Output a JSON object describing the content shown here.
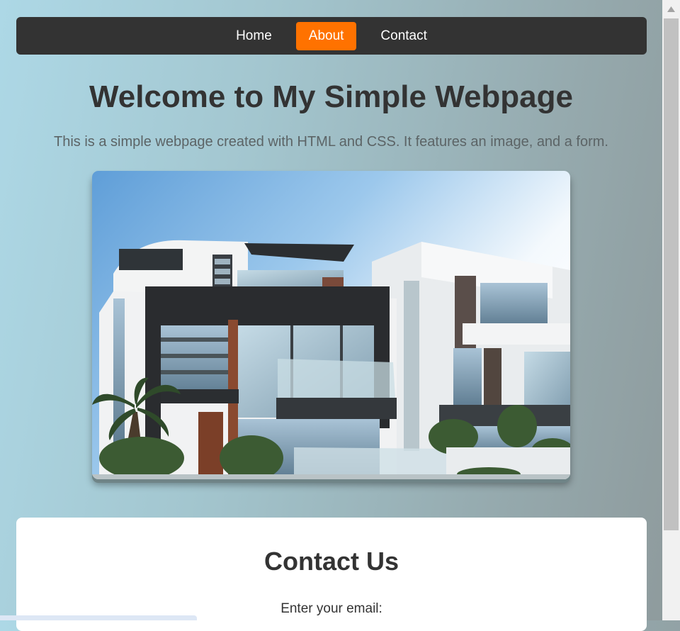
{
  "nav": {
    "items": [
      {
        "label": "Home",
        "active": false
      },
      {
        "label": "About",
        "active": true
      },
      {
        "label": "Contact",
        "active": false
      }
    ],
    "active_color": "#ff7200",
    "background": "#333333"
  },
  "main": {
    "title": "Welcome to My Simple Webpage",
    "intro": "This is a simple webpage created with HTML and CSS. It features an image, and a form.",
    "hero_image": "modern-house-photo"
  },
  "contact": {
    "title": "Contact Us",
    "email_label": "Enter your email:"
  },
  "scrollbar": {
    "up_arrow_icon": "triangle-up-icon"
  }
}
